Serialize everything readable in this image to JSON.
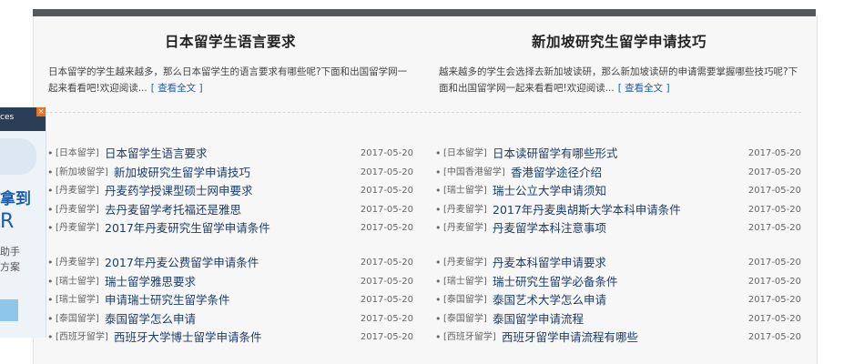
{
  "left_feature": {
    "title": "日本留学生语言要求",
    "summary": "日本留学的学生越来越多，那么日本留学生的语言要求有哪些呢?下面和出国留学网一起来看看吧!欢迎阅读...",
    "more_label": "[ 查看全文 ]"
  },
  "right_feature": {
    "title": "新加坡研究生留学申请技巧",
    "summary": "越来越多的学生会选择去新加坡读研，那么新加坡读研的申请需要掌握哪些技巧呢?下面和出国留学网一起来看看吧!欢迎阅读...",
    "more_label": "[ 查看全文 ]"
  },
  "bullet": "•",
  "left_list": [
    {
      "tag": "[日本留学]",
      "title": "日本留学生语言要求",
      "date": "2017-05-20"
    },
    {
      "tag": "[新加坡留学]",
      "title": "新加坡研究生留学申请技巧",
      "date": "2017-05-20"
    },
    {
      "tag": "[丹麦留学]",
      "title": "丹麦药学授课型硕士网申要求",
      "date": "2017-05-20"
    },
    {
      "tag": "[丹麦留学]",
      "title": "去丹麦留学考托福还是雅思",
      "date": "2017-05-20"
    },
    {
      "tag": "[丹麦留学]",
      "title": "2017年丹麦研究生留学申请条件",
      "date": "2017-05-20"
    },
    {
      "tag": "[丹麦留学]",
      "title": "2017年丹麦公费留学申请条件",
      "date": "2017-05-20"
    },
    {
      "tag": "[瑞士留学]",
      "title": "瑞士留学雅思要求",
      "date": "2017-05-20"
    },
    {
      "tag": "[瑞士留学]",
      "title": "申请瑞士研究生留学条件",
      "date": "2017-05-20"
    },
    {
      "tag": "[泰国留学]",
      "title": "泰国留学怎么申请",
      "date": "2017-05-20"
    },
    {
      "tag": "[西班牙留学]",
      "title": "西班牙大学博士留学申请条件",
      "date": "2017-05-20"
    }
  ],
  "right_list": [
    {
      "tag": "[日本留学]",
      "title": "日本读研留学有哪些形式",
      "date": "2017-05-20"
    },
    {
      "tag": "[中国香港留学]",
      "title": "香港留学途径介绍",
      "date": "2017-05-20"
    },
    {
      "tag": "[瑞士留学]",
      "title": "瑞士公立大学申请须知",
      "date": "2017-05-20"
    },
    {
      "tag": "[丹麦留学]",
      "title": "2017年丹麦奥胡斯大学本科申请条件",
      "date": "2017-05-20"
    },
    {
      "tag": "[丹麦留学]",
      "title": "丹麦留学本科注意事项",
      "date": "2017-05-20"
    },
    {
      "tag": "[丹麦留学]",
      "title": "丹麦本科留学申请要求",
      "date": "2017-05-20"
    },
    {
      "tag": "[瑞士留学]",
      "title": "瑞士研究生留学必备条件",
      "date": "2017-05-20"
    },
    {
      "tag": "[泰国留学]",
      "title": "泰国艺术大学怎么申请",
      "date": "2017-05-20"
    },
    {
      "tag": "[泰国留学]",
      "title": "泰国留学申请流程",
      "date": "2017-05-20"
    },
    {
      "tag": "[西班牙留学]",
      "title": "西班牙留学申请流程有哪些",
      "date": "2017-05-20"
    }
  ],
  "ad": {
    "header_text": "ces",
    "close": "×",
    "headline": "拿到",
    "letter": "R",
    "line1": "助手",
    "line2": "方案"
  }
}
